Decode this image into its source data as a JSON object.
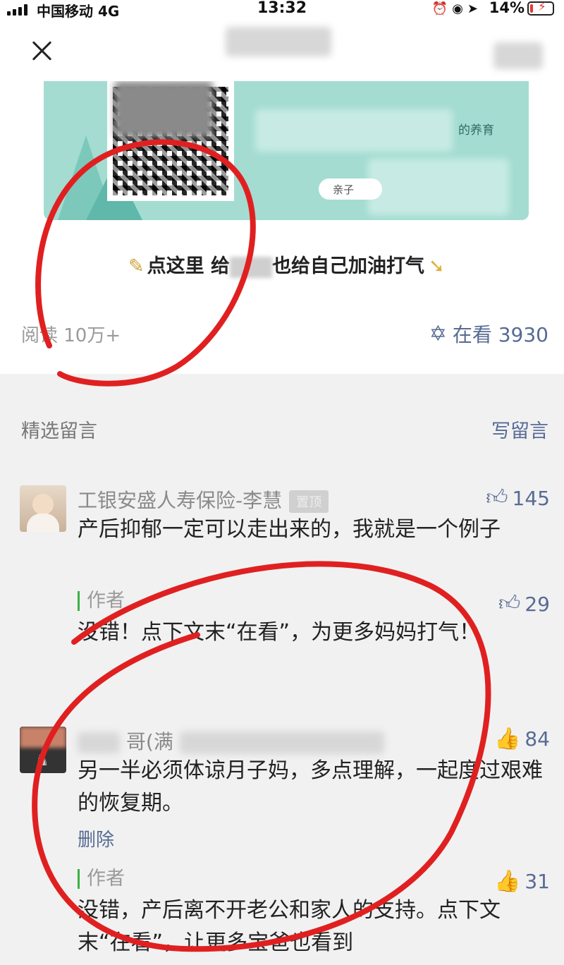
{
  "status_bar": {
    "carrier": "中国移动 4G",
    "time": "13:32",
    "battery": "14%"
  },
  "article": {
    "banner_text": "的养育",
    "banner_pill": "亲子",
    "cta_before": "点这里 给",
    "cta_after": "也给自己加油打气",
    "reads_label": "阅读 10万+",
    "wow_count_label": "在看 3930"
  },
  "comments_section": {
    "title": "精选留言",
    "write_label": "写留言"
  },
  "comments": [
    {
      "nickname": "工银安盛人寿保险-李慧",
      "badge": "置顶",
      "likes": "145",
      "text": "产后抑郁一定可以走出来的，我就是一个例子",
      "reply": {
        "label": "作者",
        "likes": "29",
        "text": "没错！点下文末“在看”，为更多妈妈打气！"
      }
    },
    {
      "nickname": "哥(满",
      "likes": "84",
      "text": "另一半必须体谅月子妈，多点理解，一起度过艰难的恢复期。",
      "delete_label": "删除",
      "reply": {
        "label": "作者",
        "likes": "31",
        "text": "没错，产后离不开老公和家人的支持。点下文末“在看”，让更多宝爸也看到"
      }
    }
  ],
  "icons": {
    "close": "close-icon",
    "wow": "wow-icon",
    "like": "thumbs-up-icon"
  },
  "colors": {
    "link": "#576b95",
    "annotation": "#e02020",
    "banner": "#a4dcd2"
  }
}
